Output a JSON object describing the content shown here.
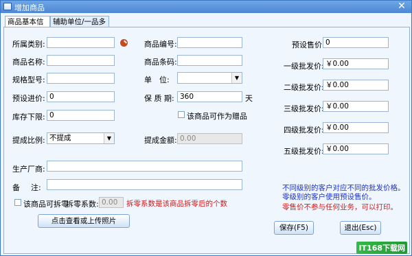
{
  "window": {
    "title": "增加商品",
    "close_glyph": "✕"
  },
  "tabs": [
    {
      "label": "商品基本信息",
      "active": true
    },
    {
      "label": "辅助单位/一品多码",
      "active": false
    }
  ],
  "form": {
    "category": {
      "label": "所属类别:",
      "value": ""
    },
    "name": {
      "label": "商品名称:",
      "value": ""
    },
    "spec": {
      "label": "规格型号:",
      "value": ""
    },
    "purchase_price": {
      "label": "预设进价:",
      "value": "0"
    },
    "stock_min": {
      "label": "库存下限:",
      "value": "0"
    },
    "commission_ratio": {
      "label": "提成比例:",
      "value": "不提成"
    },
    "code": {
      "label": "商品编号:",
      "value": ""
    },
    "barcode": {
      "label": "商品条码:",
      "value": ""
    },
    "unit": {
      "label1": "单",
      "label2": "位:",
      "value": ""
    },
    "shelf_life": {
      "label": "保 质 期:",
      "value": "360",
      "suffix": "天"
    },
    "gift_checkbox": {
      "label": "该商品可作为赠品",
      "checked": false
    },
    "commission_amount": {
      "label": "提成金额:",
      "value": "0.00"
    },
    "manufacturer": {
      "label": "生产厂商:",
      "value": ""
    },
    "remark": {
      "label1": "备",
      "label2": "注:",
      "value": ""
    },
    "split_checkbox": {
      "label": "该商品可拆零",
      "checked": false
    },
    "split_factor": {
      "label": "拆零系数:",
      "value": "0.00",
      "hint": "拆零系数是该商品拆零后的个数"
    }
  },
  "prices": {
    "preset_sale": {
      "label": "预设售价:",
      "value": "0"
    },
    "levels": [
      {
        "label": "一级批发价:",
        "value": "￥0.00"
      },
      {
        "label": "二级批发价:",
        "value": "￥0.00"
      },
      {
        "label": "三级批发价:",
        "value": "￥0.00"
      },
      {
        "label": "四级批发价:",
        "value": "￥0.00"
      },
      {
        "label": "五级批发价:",
        "value": "￥0.00"
      }
    ]
  },
  "notes": {
    "blue_line1": "不同级别的客户对应不同的批发价格。",
    "blue_line2": "零级别的客户使用预设售价。",
    "red_line": "零售价不参与任何业务，可以打印。"
  },
  "buttons": {
    "photo": "点击查看或上传照片",
    "save": "保存(F5)",
    "exit": "退出(Esc)"
  },
  "watermark": "IT168下载网",
  "colors": {
    "blue_note": "#1b33c8",
    "red_note": "#d11a1a",
    "title_bar": "#4d87d3"
  }
}
